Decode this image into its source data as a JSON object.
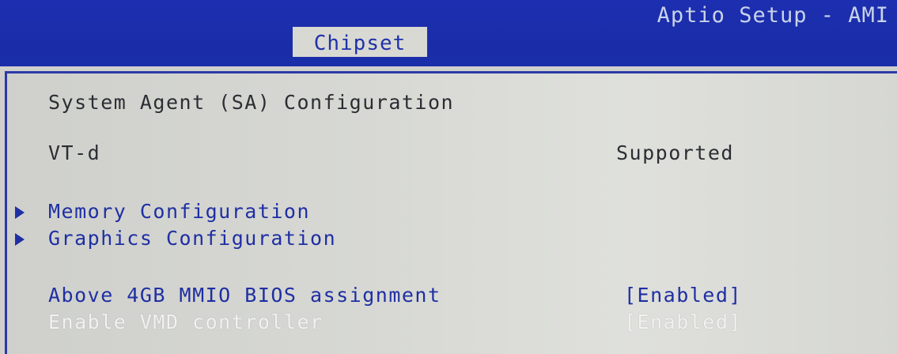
{
  "header": {
    "app_title": "Aptio Setup - AMI",
    "active_tab": "Chipset"
  },
  "panel": {
    "title": "System Agent (SA) Configuration",
    "vtd": {
      "label": "VT-d",
      "value": "Supported"
    },
    "submenus": [
      {
        "label": "Memory Configuration",
        "icon": "triangle-right-icon"
      },
      {
        "label": "Graphics Configuration",
        "icon": "triangle-right-icon"
      }
    ],
    "settings": [
      {
        "label": "Above 4GB MMIO BIOS assignment",
        "value": "[Enabled]"
      },
      {
        "label": "Enable VMD controller",
        "value": "[Enabled]"
      }
    ]
  },
  "colors": {
    "header_bg": "#1c2fb0",
    "tab_bg": "#d9d9d4",
    "text_blue": "#1f2fa3",
    "text_dark": "#2b2d33",
    "text_highlight": "#f2f2f2",
    "panel_bg": "#d7d8d3"
  }
}
